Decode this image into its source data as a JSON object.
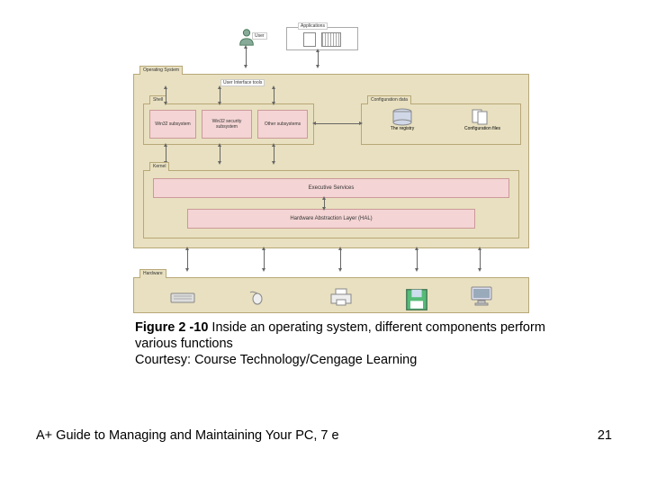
{
  "diagram": {
    "top_user_label": "User",
    "top_apps_label": "Applications",
    "os_panel": "Operating System",
    "ui_tools": "User Interface tools",
    "shell": "Shell",
    "shell_subs": [
      "Win32 subsystem",
      "Win32 security subsystem",
      "Other subsystems"
    ],
    "config_panel": "Configuration data",
    "config_subs": [
      "The registry",
      "Configuration files"
    ],
    "kernel": "Kernel",
    "exec_services": "Executive Services",
    "hal": "Hardware Abstraction Layer (HAL)",
    "hardware_panel": "Hardware"
  },
  "caption": {
    "fig_num": "Figure 2 -10 ",
    "fig_text": "Inside an operating system, different components perform various functions",
    "courtesy": "Courtesy: Course Technology/Cengage Learning"
  },
  "footer": {
    "book": "A+ Guide to Managing and Maintaining Your PC, 7 e",
    "page": "21"
  }
}
